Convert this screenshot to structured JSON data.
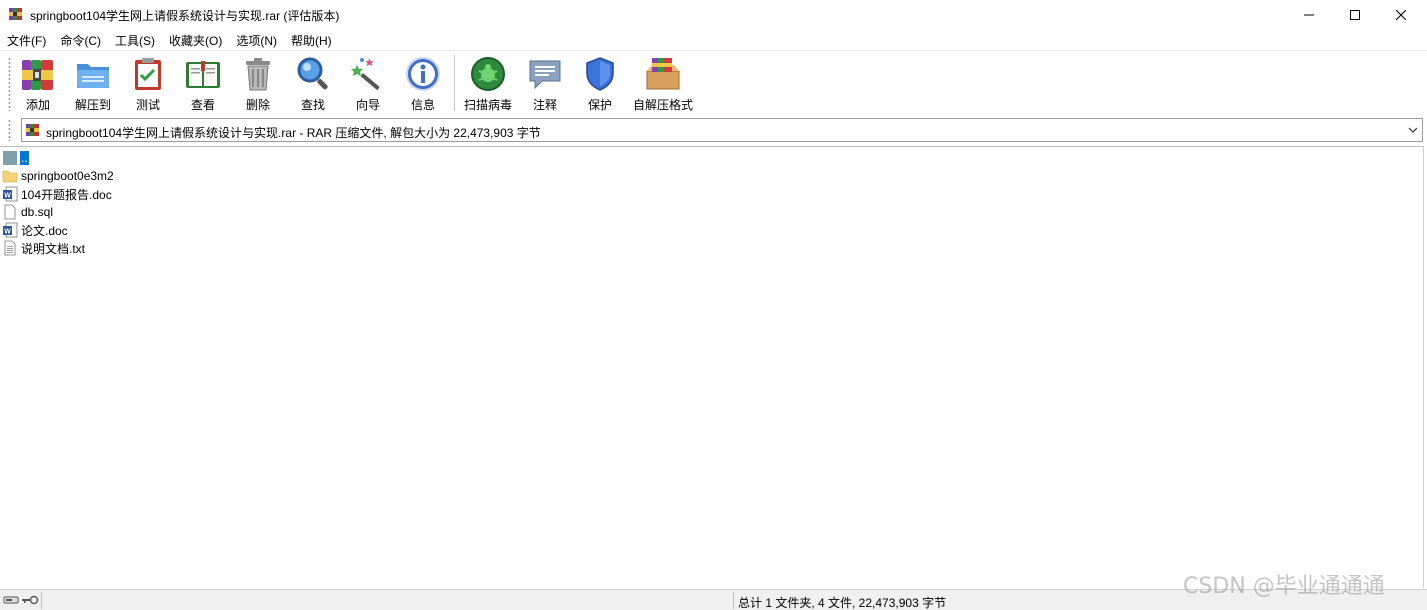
{
  "window": {
    "title": "springboot104学生网上请假系统设计与实现.rar (评估版本)",
    "icon": "winrar-icon"
  },
  "menu": [
    "文件(F)",
    "命令(C)",
    "工具(S)",
    "收藏夹(O)",
    "选项(N)",
    "帮助(H)"
  ],
  "toolbar": [
    {
      "label": "添加",
      "icon": "add-archive-icon"
    },
    {
      "label": "解压到",
      "icon": "extract-to-folder-icon"
    },
    {
      "label": "测试",
      "icon": "test-clipboard-icon"
    },
    {
      "label": "查看",
      "icon": "view-book-icon"
    },
    {
      "label": "删除",
      "icon": "delete-trash-icon"
    },
    {
      "label": "查找",
      "icon": "find-magnifier-icon"
    },
    {
      "label": "向导",
      "icon": "wizard-wand-icon"
    },
    {
      "label": "信息",
      "icon": "info-icon"
    },
    {
      "label": "扫描病毒",
      "icon": "virus-scan-icon"
    },
    {
      "label": "注释",
      "icon": "comment-icon"
    },
    {
      "label": "保护",
      "icon": "protect-shield-icon"
    },
    {
      "label": "自解压格式",
      "icon": "sfx-box-icon"
    }
  ],
  "address": {
    "text": "springboot104学生网上请假系统设计与实现.rar - RAR 压缩文件, 解包大小为 22,473,903 字节"
  },
  "files": [
    {
      "name": "..",
      "icon": "parent-folder-icon",
      "selected": true
    },
    {
      "name": "springboot0e3m2",
      "icon": "folder-icon",
      "selected": false
    },
    {
      "name": "104开题报告.doc",
      "icon": "word-doc-icon",
      "selected": false
    },
    {
      "name": "db.sql",
      "icon": "blank-file-icon",
      "selected": false
    },
    {
      "name": "论文.doc",
      "icon": "word-doc-icon",
      "selected": false
    },
    {
      "name": "说明文档.txt",
      "icon": "text-file-icon",
      "selected": false
    }
  ],
  "status": {
    "text": "总计 1 文件夹, 4 文件, 22,473,903 字节"
  },
  "watermark": "CSDN @毕业通通通",
  "colors": {
    "selection": "#0078d7",
    "statusbar": "#f0f0f0"
  }
}
